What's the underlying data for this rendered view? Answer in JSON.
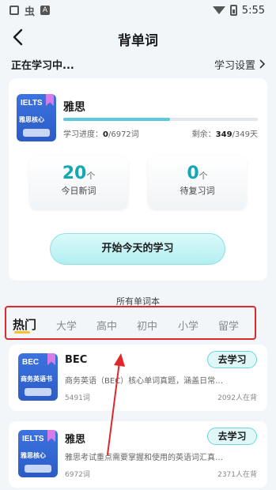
{
  "status_bar": {
    "left_char": "虫",
    "left_badge": "A",
    "time": "5:55"
  },
  "header": {
    "title": "背单词"
  },
  "learning": {
    "label": "正在学习中...",
    "settings_label": "学习设置",
    "book": {
      "cover_top": "IELTS",
      "cover_sub": "雅思核心",
      "name": "雅思",
      "progress_label": "学习进度：",
      "progress_done": "0",
      "progress_total": "/6972词",
      "progress_fraction": 0.55,
      "remaining_label": "剩余：",
      "remaining_value": "349",
      "remaining_total": "/349天"
    },
    "stats": [
      {
        "value": "20",
        "unit": "个",
        "label": "今日新词"
      },
      {
        "value": "0",
        "unit": "个",
        "label": "待复习词"
      }
    ],
    "start_button": "开始今天的学习"
  },
  "all_books_label": "所有单词本",
  "tabs": [
    {
      "label": "热门",
      "active": true
    },
    {
      "label": "大学",
      "active": false
    },
    {
      "label": "高中",
      "active": false
    },
    {
      "label": "初中",
      "active": false
    },
    {
      "label": "小学",
      "active": false
    },
    {
      "label": "留学",
      "active": false
    }
  ],
  "books": [
    {
      "cover_top": "BEC",
      "cover_sub": "商务英语书",
      "title": "BEC",
      "button": "去学习",
      "description": "商务英语（BEC）核心单词真题，涵盖日常…",
      "count": "5491词",
      "learners": "2092人在背"
    },
    {
      "cover_top": "IELTS",
      "cover_sub": "雅思核心",
      "title": "雅思",
      "button": "去学习",
      "description": "雅思考试重点需要掌握和使用的英语词汇真…",
      "count": "6972词",
      "learners": "2371人在背"
    }
  ],
  "colors": {
    "accent": "#13a8b4",
    "progress": "#5ac9da",
    "highlight_border": "#e0282a",
    "arrow": "#e0282a",
    "tab_underline": "#f6c22d"
  }
}
